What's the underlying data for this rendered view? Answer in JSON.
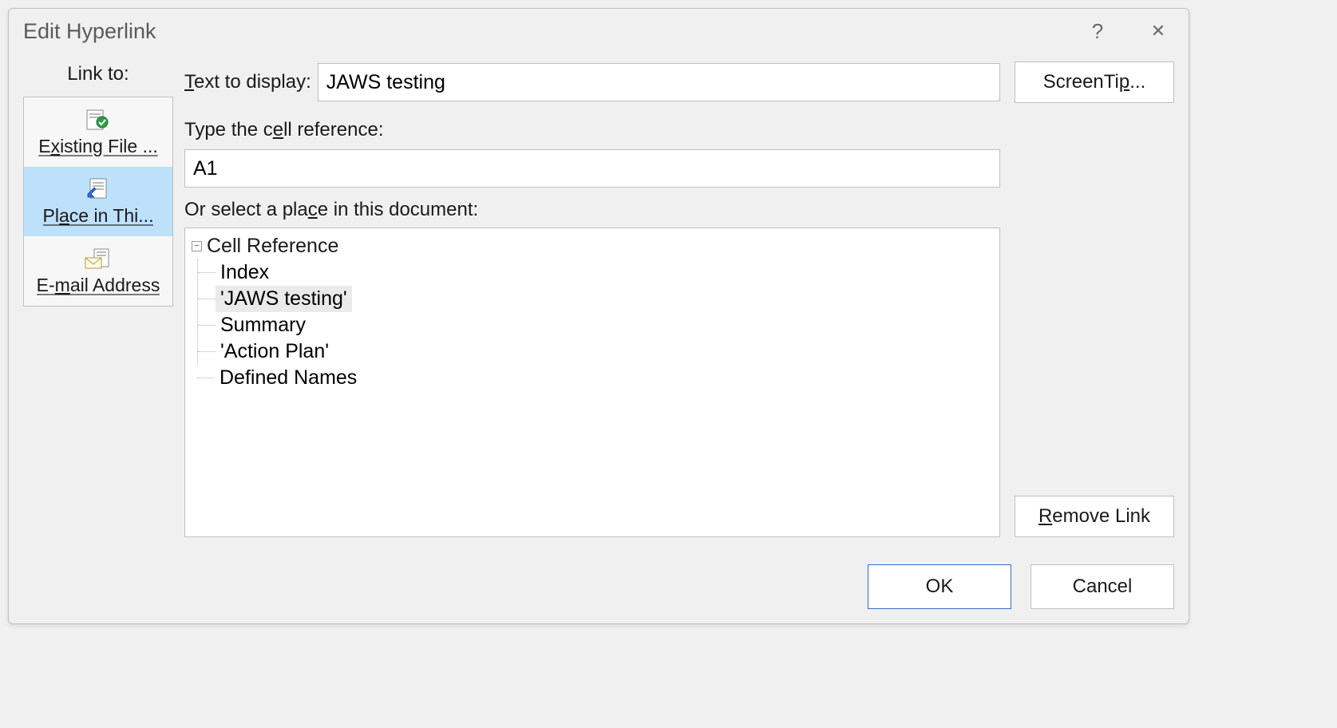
{
  "dialog": {
    "title": "Edit Hyperlink",
    "help_symbol": "?",
    "close_symbol": "✕"
  },
  "linkto": {
    "heading": "Link to:",
    "items": [
      {
        "label": "Existing File ...",
        "selected": false
      },
      {
        "label": "Place in Thi...",
        "selected": true
      },
      {
        "label": "E-mail Address",
        "selected": false
      }
    ]
  },
  "fields": {
    "text_to_display_label": "Text to display:",
    "text_to_display_value": "JAWS testing",
    "cell_reference_label": "Type the cell reference:",
    "cell_reference_value": "A1",
    "select_place_label": "Or select a place in this document:"
  },
  "tree": {
    "root": "Cell Reference",
    "children": [
      {
        "label": "Index",
        "selected": false
      },
      {
        "label": "'JAWS testing'",
        "selected": true
      },
      {
        "label": "Summary",
        "selected": false
      },
      {
        "label": "'Action Plan'",
        "selected": false
      }
    ],
    "sibling": "Defined Names"
  },
  "buttons": {
    "screentip": "ScreenTip...",
    "remove_link": "Remove Link",
    "ok": "OK",
    "cancel": "Cancel"
  }
}
